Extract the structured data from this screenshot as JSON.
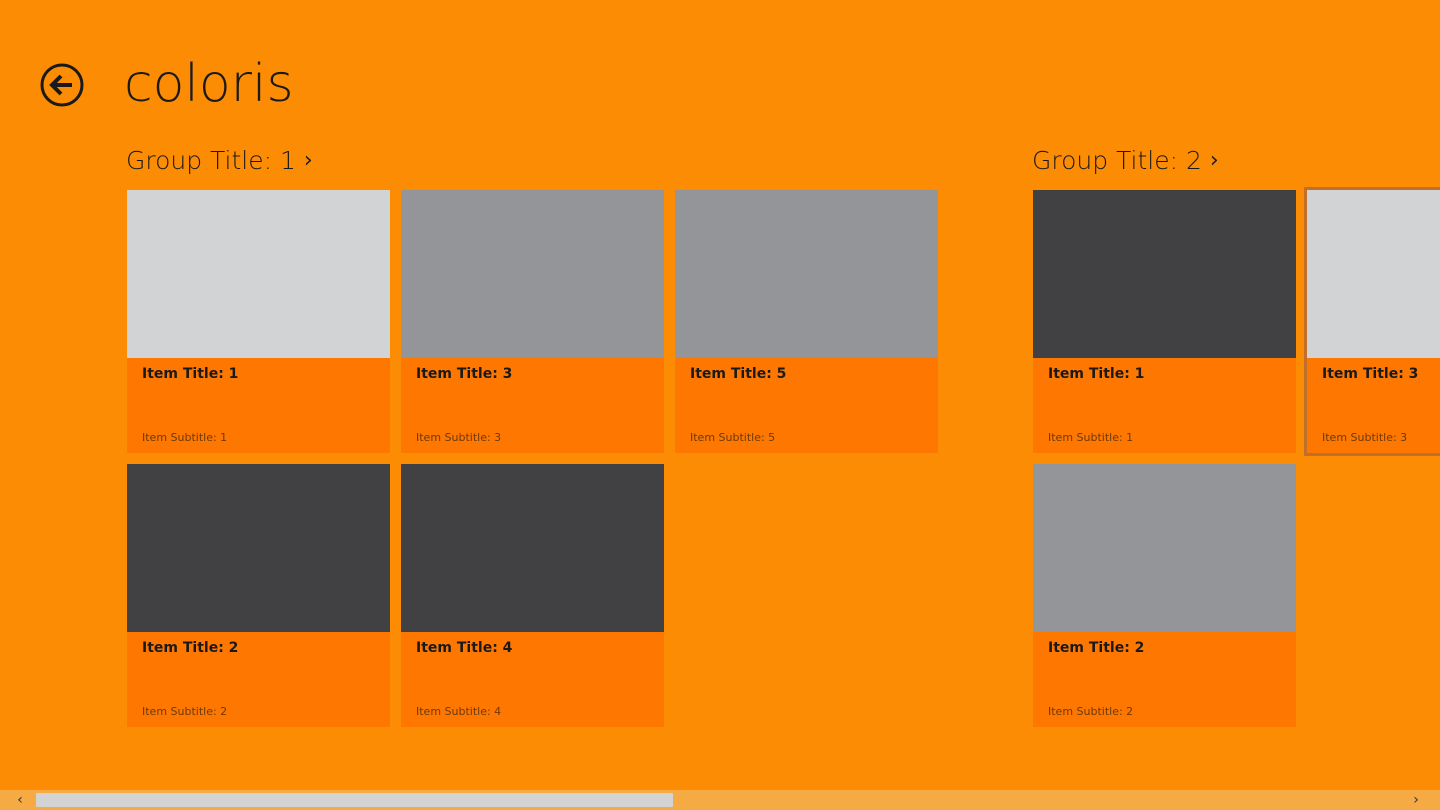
{
  "page": {
    "title": "coloris",
    "background": "#fc8c03"
  },
  "back_button": {
    "icon": "back-arrow-icon"
  },
  "groups": [
    {
      "title": "Group Title: 1",
      "chevron": "›",
      "items": [
        {
          "title": "Item Title: 1",
          "subtitle": "Item Subtitle: 1",
          "color": "#d1d3d4"
        },
        {
          "title": "Item Title: 2",
          "subtitle": "Item Subtitle: 2",
          "color": "#414042"
        },
        {
          "title": "Item Title: 3",
          "subtitle": "Item Subtitle: 3",
          "color": "#939598"
        },
        {
          "title": "Item Title: 4",
          "subtitle": "Item Subtitle: 4",
          "color": "#414042"
        },
        {
          "title": "Item Title: 5",
          "subtitle": "Item Subtitle: 5",
          "color": "#939598"
        }
      ]
    },
    {
      "title": "Group Title: 2",
      "chevron": "›",
      "items": [
        {
          "title": "Item Title: 1",
          "subtitle": "Item Subtitle: 1",
          "color": "#414042"
        },
        {
          "title": "Item Title: 2",
          "subtitle": "Item Subtitle: 2",
          "color": "#939598"
        },
        {
          "title": "Item Title: 3",
          "subtitle": "Item Subtitle: 3",
          "color": "#d1d3d4",
          "selected": true
        }
      ]
    }
  ],
  "colors": {
    "accent_orange": "#fc8c03",
    "tile_info": "#fe7700",
    "selection_border": "#c0702c"
  },
  "scrollbar": {
    "left_arrow": "‹",
    "right_arrow": "›"
  }
}
